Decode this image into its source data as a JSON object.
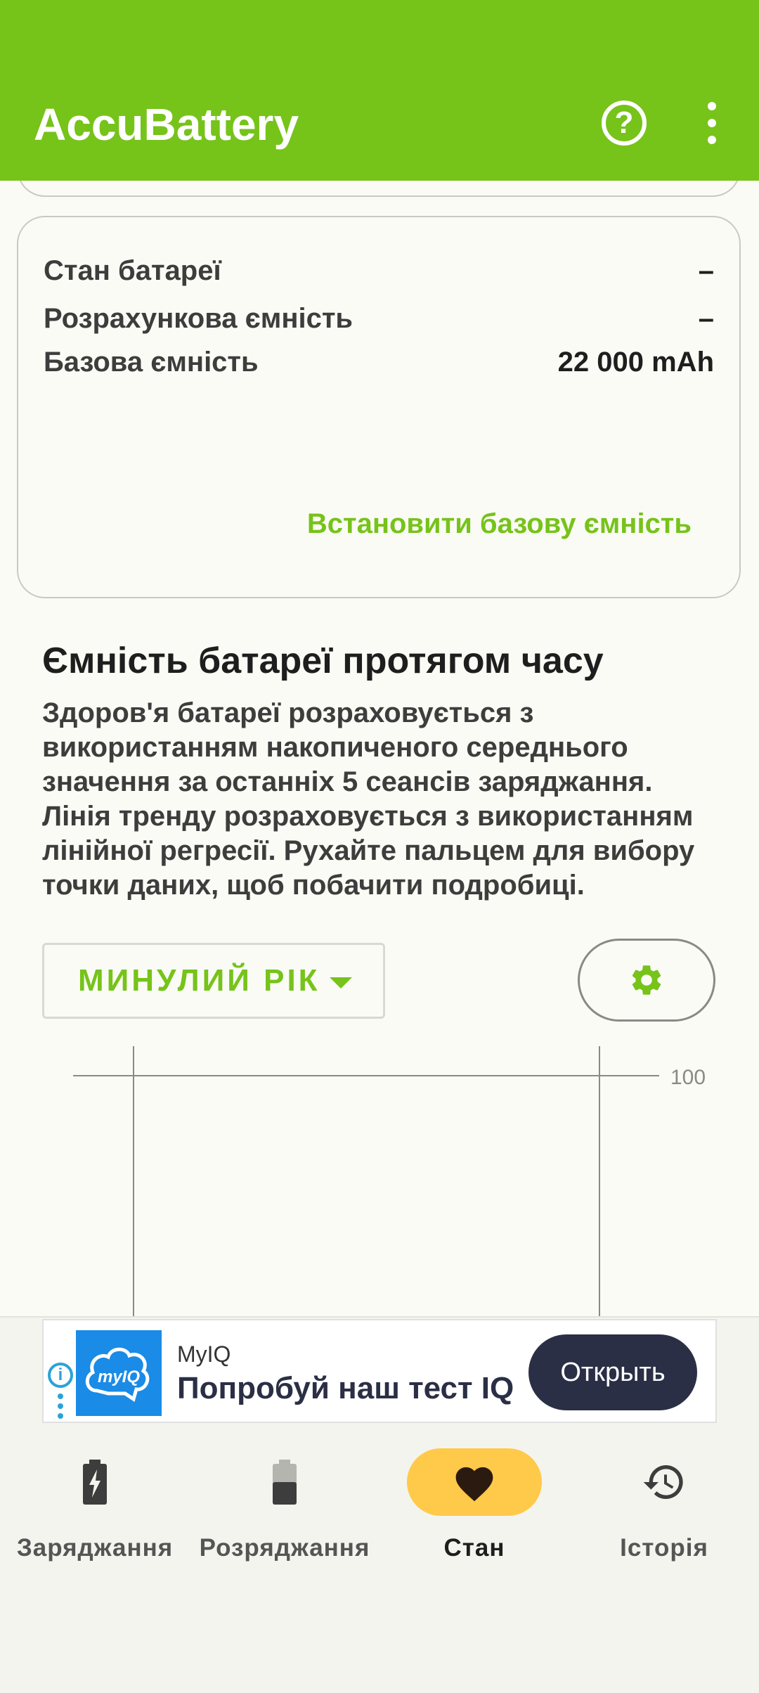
{
  "app": {
    "title": "AccuBattery",
    "accent_color": "#76c31a",
    "help_icon": "help-circle-icon",
    "more_icon": "more-vert-icon"
  },
  "info_card": {
    "rows": [
      {
        "label": "Стан батареї",
        "value": "–"
      },
      {
        "label": "Розрахункова ємність",
        "value": "–"
      },
      {
        "label": "Базова ємність",
        "value": "22 000 mAh"
      }
    ],
    "action_label": "Встановити базову ємність"
  },
  "section": {
    "title": "Ємність батареї протягом часу",
    "description": "Здоров'я батареї розраховується з використанням накопиченого середнього значення за останніх 5 сеансів заряджання. Лінія тренду розраховується з використанням лінійної регресії. Рухайте пальцем для вибору точки даних, щоб побачити подробиці."
  },
  "controls": {
    "period_label": "МИНУЛИЙ РІК",
    "settings_icon": "gear-icon"
  },
  "chart_data": {
    "type": "line",
    "series": [],
    "y_tick_labels": [
      "100"
    ]
  },
  "ad": {
    "brand": "MyIQ",
    "logo_text": "myIQ",
    "text": "Попробуй наш тест IQ",
    "button_label": "Открыть",
    "info_icon": "info-icon"
  },
  "nav": {
    "items": [
      {
        "label": "Заряджання",
        "icon": "battery-charging-icon"
      },
      {
        "label": "Розряджання",
        "icon": "battery-discharging-icon"
      },
      {
        "label": "Стан",
        "icon": "heart-icon",
        "active": true
      },
      {
        "label": "Історія",
        "icon": "history-icon"
      }
    ],
    "active_color": "#ffc94a"
  }
}
